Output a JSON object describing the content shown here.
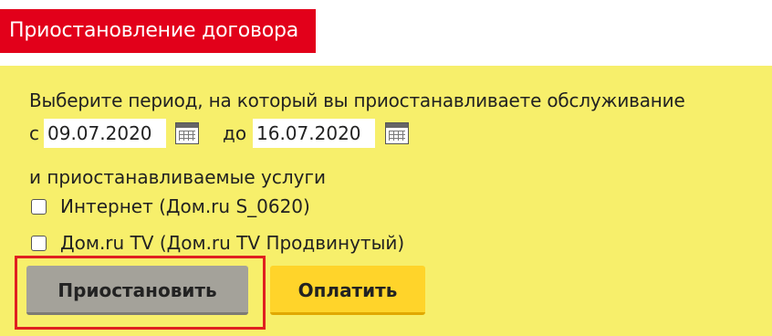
{
  "header": {
    "title": "Приостановление договора"
  },
  "form": {
    "period_prompt": "Выберите период, на который вы приостанавливаете обслуживание",
    "from_prefix": "с",
    "from_date": "09.07.2020",
    "to_prefix": "до",
    "to_date": "16.07.2020",
    "services_label": "и приостанавливаемые услуги",
    "services": [
      {
        "label": "Интернет (Дом.ru S_0620)",
        "checked": false
      },
      {
        "label": "Дом.ru TV (Дом.ru TV Продвинутый)",
        "checked": false
      }
    ]
  },
  "actions": {
    "suspend_label": "Приостановить",
    "pay_label": "Оплатить"
  },
  "colors": {
    "header_bg": "#e2001a",
    "panel_bg": "#f7ef6b",
    "pay_button": "#ffd42a",
    "suspend_button": "#a4a29a",
    "highlight_border": "#e02020"
  },
  "icons": [
    "calendar-icon",
    "checkbox-icon"
  ]
}
